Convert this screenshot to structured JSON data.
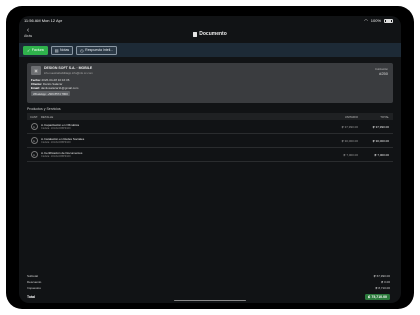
{
  "status_bar": {
    "time": "11:56 AM",
    "date": "Mon 12 Apr",
    "battery": "100%"
  },
  "navbar": {
    "back_label": "Atrás",
    "title": "Documento"
  },
  "toolbar": {
    "buttons": [
      {
        "label": "Factura",
        "icon": "check-icon",
        "active": true
      },
      {
        "label": "Notas",
        "icon": "note-icon",
        "active": false
      },
      {
        "label": "Respuesta Inteli...",
        "icon": "clock-icon",
        "active": false
      }
    ]
  },
  "header_card": {
    "company": "DESIGN SOFT S.A. · MOBILE",
    "company_email": "info.nuestrahabilitiapp.info@mk.cc.com",
    "fecha_label": "Fecha:",
    "fecha": "2026-04-28 10:16:36",
    "cliente_label": "Cliente:",
    "cliente": "Danilo Salazar",
    "email_label": "Email:",
    "email": "danilosalazar11@gmail.com",
    "whatsapp": "WhatsApp: +506 8574 7800",
    "quote_label": "Cotización",
    "quote_number": "#250"
  },
  "section_title": "Productos y Servicios",
  "table": {
    "headers": {
      "qty": "CANT.",
      "detail": "DETALLE",
      "unit": "UNITARIO",
      "total": "TOTAL"
    },
    "rows": [
      {
        "qty": "1",
        "product": "A·Capacitación en Ofimática",
        "sub": "Cédula: 101/ACOBP3100",
        "unit": "₡ 37,990.00",
        "total": "₡ 37,990.00"
      },
      {
        "qty": "1",
        "product": "A·Instalación en Redes Sociales",
        "sub": "Cédula: 101/ACOBP3100",
        "unit": "₡ 30,000.00",
        "total": "₡ 30,000.00"
      },
      {
        "qty": "1",
        "product": "A·Certificación de Documentos",
        "sub": "Cédula: 101/ACOBP3100",
        "unit": "₡ 7,000.00",
        "total": "₡ 7,000.00"
      }
    ]
  },
  "totals": [
    {
      "label": "Subtotal",
      "value": "₡ 67,990.00"
    },
    {
      "label": "Descuento",
      "value": "₡ 0.00"
    },
    {
      "label": "Impuestos",
      "value": "₡ 8,710.00"
    }
  ],
  "grand_total": {
    "label": "Total",
    "value": "₡ 75,710.00"
  },
  "colors": {
    "accent": "#2fb24c",
    "toolbar": "#1d2a36",
    "card": "#3a3c3f"
  }
}
